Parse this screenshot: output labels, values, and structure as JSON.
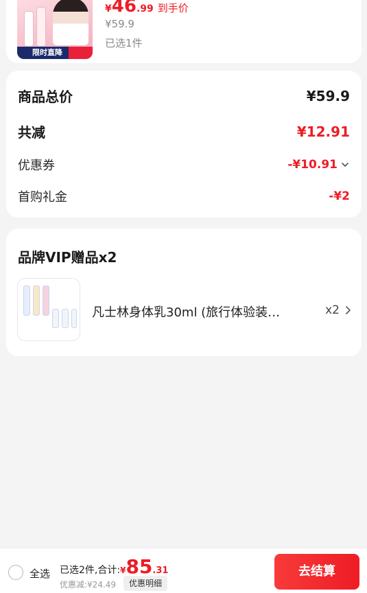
{
  "product": {
    "price_currency": "¥",
    "price_int": "46",
    "price_dec": ".99",
    "price_tag": "到手价",
    "original_price": "¥59.9",
    "selected": "已选1件",
    "thumb_banner": "限时直降"
  },
  "summary": {
    "total_label": "商品总价",
    "total_value": "¥59.9",
    "reduce_label": "共减",
    "reduce_value": "¥12.91",
    "coupon_label": "优惠券",
    "coupon_value": "-¥10.91",
    "gift_cash_label": "首购礼金",
    "gift_cash_value": "-¥2"
  },
  "gift": {
    "title": "品牌VIP赠品x2",
    "name": "凡士林身体乳30ml (旅行体验装…",
    "qty": "x2"
  },
  "bottom": {
    "select_all": "全选",
    "selected_total_label": "已选2件,合计:",
    "total_currency": "¥",
    "total_int": "85",
    "total_dec": ".31",
    "discount": "优惠减:¥24.49",
    "detail": "优惠明细",
    "checkout": "去结算"
  },
  "colors": {
    "accent": "#ee1c25",
    "background": "#f4f4f4"
  }
}
